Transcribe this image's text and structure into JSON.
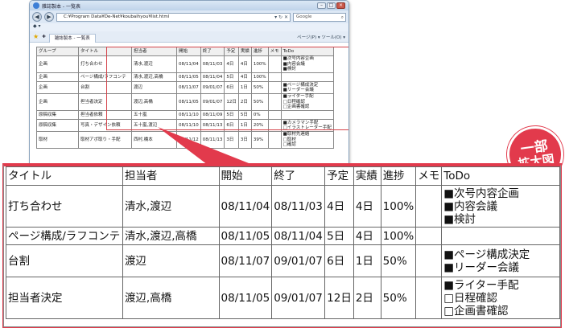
{
  "browser": {
    "window_title": "雑誌製本 - 一覧表",
    "address": "C:¥Program Data¥De-Net¥koubaihyou¥list.html",
    "search_placeholder": "Google",
    "tab_label": "雑誌製本 - 一覧表",
    "toolbar_tools": "ページ(P) ▾  ツール(O) ▾"
  },
  "columns": [
    "タイトル",
    "担当者",
    "開始",
    "終了",
    "予定",
    "実績",
    "進捗",
    "メモ",
    "ToDo"
  ],
  "small_table": {
    "group_header": "グループ",
    "rows": [
      {
        "group": "企画",
        "title": "打ち合わせ",
        "owner": "清水,渡辺",
        "start": "08/11/04",
        "end": "08/11/03",
        "plan": "4日",
        "actual": "4日",
        "progress": "100%",
        "memo": "",
        "todo": [
          "■次号内容企画",
          "■内容会議",
          "■検討"
        ]
      },
      {
        "group": "企画",
        "title": "ページ構成/ラフコンテ",
        "owner": "清水,渡辺,高橋",
        "start": "08/11/05",
        "end": "08/11/04",
        "plan": "5日",
        "actual": "4日",
        "progress": "100%",
        "memo": "",
        "todo": []
      },
      {
        "group": "企画",
        "title": "台割",
        "owner": "渡辺",
        "start": "08/11/07",
        "end": "09/01/07",
        "plan": "6日",
        "actual": "1日",
        "progress": "50%",
        "memo": "",
        "todo": [
          "■ページ構成決定",
          "■リーダー会議"
        ]
      },
      {
        "group": "企画",
        "title": "担当者決定",
        "owner": "渡辺,高橋",
        "start": "08/11/05",
        "end": "09/01/07",
        "plan": "12日",
        "actual": "2日",
        "progress": "50%",
        "memo": "",
        "todo": [
          "■ライター手配",
          "□日程確認",
          "□企画書確認"
        ]
      },
      {
        "group": "原稿収集",
        "title": "担当者依頼",
        "owner": "五十嵐",
        "start": "08/11/10",
        "end": "08/11/09",
        "plan": "5日",
        "actual": "5日",
        "progress": "0%",
        "memo": "",
        "todo": []
      },
      {
        "group": "原稿収集",
        "title": "写真・デザイン依頼",
        "owner": "五十嵐,渡辺",
        "start": "08/11/10",
        "end": "08/11/13",
        "plan": "6日",
        "actual": "1日",
        "progress": "20%",
        "memo": "",
        "todo": [
          "■カメラマン手配",
          "□イラストレーター手配"
        ]
      },
      {
        "group": "取材",
        "title": "取材アポ取り・手配",
        "owner": "西村,橋本",
        "start": "08/11/12",
        "end": "08/11/13",
        "plan": "3日",
        "actual": "3日",
        "progress": "39%",
        "memo": "",
        "todo": [
          "■取材先連絡",
          "□取材",
          "□確認"
        ]
      }
    ]
  },
  "big_table": {
    "rows": [
      {
        "title": "打ち合わせ",
        "owner": "清水,渡辺",
        "start": "08/11/04",
        "end": "08/11/03",
        "plan": "4日",
        "actual": "4日",
        "progress": "100%",
        "memo": "",
        "todo": [
          "■次号内容企画",
          "■内容会議",
          "■検討"
        ]
      },
      {
        "title": "ページ構成/ラフコンテ",
        "owner": "清水,渡辺,高橋",
        "start": "08/11/05",
        "end": "08/11/04",
        "plan": "5日",
        "actual": "4日",
        "progress": "100%",
        "memo": "",
        "todo": []
      },
      {
        "title": "台割",
        "owner": "渡辺",
        "start": "08/11/07",
        "end": "09/01/07",
        "plan": "6日",
        "actual": "1日",
        "progress": "50%",
        "memo": "",
        "todo": [
          "■ページ構成決定",
          "■リーダー会議"
        ]
      },
      {
        "title": "担当者決定",
        "owner": "渡辺,高橋",
        "start": "08/11/05",
        "end": "09/01/07",
        "plan": "12日",
        "actual": "2日",
        "progress": "50%",
        "memo": "",
        "todo": [
          "■ライター手配",
          "□日程確認",
          "□企画書確認"
        ]
      }
    ]
  },
  "badge": {
    "line1": "一部",
    "line2": "拡大図"
  },
  "colors": {
    "accent_red": "#e23a4c",
    "window_frame": "#8aa3bd"
  }
}
